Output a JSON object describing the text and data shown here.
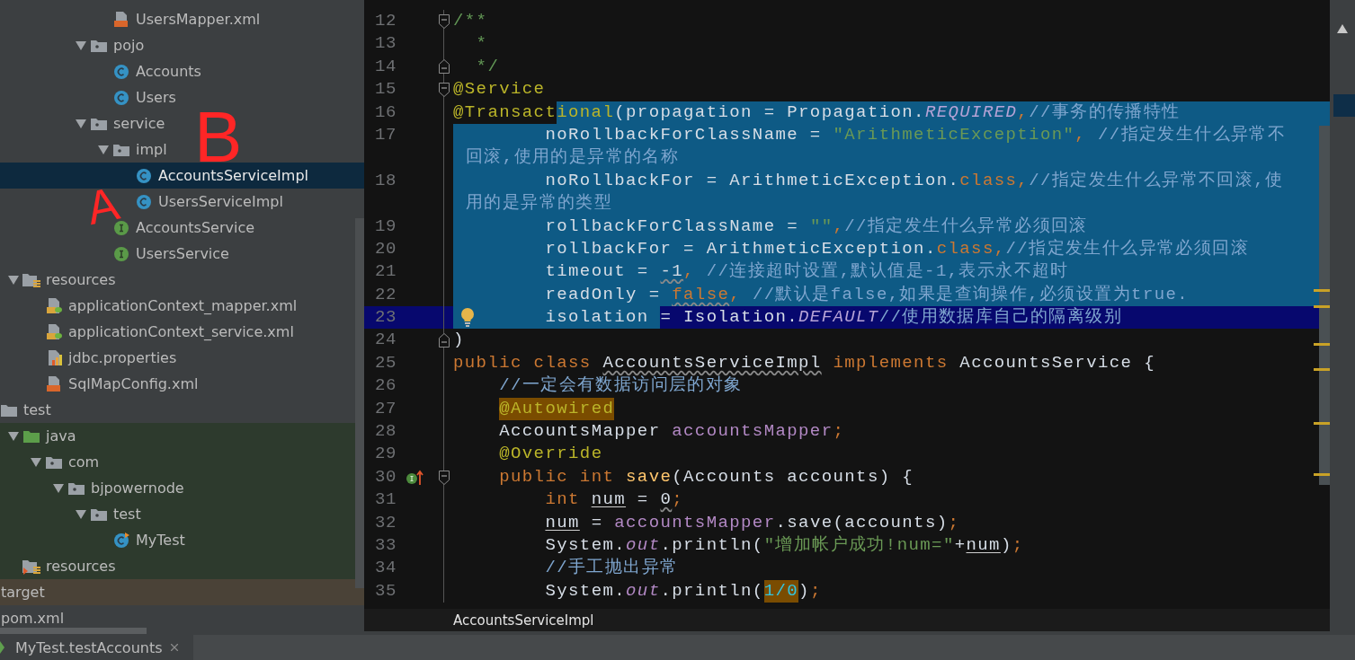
{
  "project_tree": {
    "items": [
      {
        "children": [
          {
            "children": [
              {
                "children": [
                  {
                    "children": [
                      {
                        "children": [
                          {
                            "children": [
                              {
                                "label": "UsersMapper.xml",
                                "kind": "xml",
                                "selected": false
                              }
                            ]
                          },
                          {
                            "label": "pojo",
                            "kind": "package",
                            "expanded": true,
                            "selected": false,
                            "children": [
                              {
                                "label": "Accounts",
                                "kind": "class",
                                "selected": false
                              },
                              {
                                "label": "Users",
                                "kind": "class",
                                "selected": false
                              }
                            ]
                          },
                          {
                            "label": "service",
                            "kind": "package",
                            "expanded": true,
                            "selected": false,
                            "children": [
                              {
                                "label": "impl",
                                "kind": "package",
                                "expanded": true,
                                "selected": false,
                                "children": [
                                  {
                                    "label": "AccountsServiceImpl",
                                    "kind": "class",
                                    "selected": true
                                  },
                                  {
                                    "label": "UsersServiceImpl",
                                    "kind": "class",
                                    "selected": false
                                  }
                                ]
                              },
                              {
                                "label": "AccountsService",
                                "kind": "interface",
                                "selected": false
                              },
                              {
                                "label": "UsersService",
                                "kind": "interface",
                                "selected": false
                              }
                            ]
                          }
                        ]
                      }
                    ]
                  }
                ]
              },
              {
                "label": "resources",
                "kind": "resources",
                "expanded": true,
                "selected": false,
                "children": [
                  {
                    "label": "applicationContext_mapper.xml",
                    "kind": "spring",
                    "selected": false
                  },
                  {
                    "label": "applicationContext_service.xml",
                    "kind": "spring",
                    "selected": false
                  },
                  {
                    "label": "jdbc.properties",
                    "kind": "properties",
                    "selected": false
                  },
                  {
                    "label": "SqlMapConfig.xml",
                    "kind": "xml",
                    "selected": false
                  }
                ]
              }
            ]
          },
          {
            "label": "test",
            "kind": "folder",
            "selected": false,
            "children": [
              {
                "label": "java",
                "kind": "source",
                "expanded": true,
                "selected": false,
                "color": "#2d3a2d",
                "children": [
                  {
                    "label": "com",
                    "kind": "package",
                    "expanded": true,
                    "selected": false,
                    "color": "#2d3a2d",
                    "children": [
                      {
                        "label": "bjpowernode",
                        "kind": "package",
                        "expanded": true,
                        "selected": false,
                        "color": "#2d3a2d",
                        "children": [
                          {
                            "label": "test",
                            "kind": "package",
                            "expanded": true,
                            "selected": false,
                            "color": "#2d3a2d",
                            "children": [
                              {
                                "label": "MyTest",
                                "kind": "testclass",
                                "selected": false,
                                "color": "#2d3a2d"
                              }
                            ]
                          }
                        ]
                      }
                    ]
                  }
                ]
              },
              {
                "label": "resources",
                "kind": "testresources",
                "selected": false,
                "color": "#2d3a2d"
              }
            ]
          }
        ]
      },
      {
        "label": "target",
        "selected": false,
        "color": "#4a4237"
      },
      {
        "label": "pom.xml",
        "selected": false
      }
    ]
  },
  "editor": {
    "lines": [
      {
        "number": "12",
        "fold_start": true,
        "selected": false,
        "current": false,
        "tokens": [
          {
            "text": "/**",
            "kind": "doc"
          }
        ]
      },
      {
        "number": "13",
        "selected": false,
        "current": false,
        "tokens": [
          {
            "text": "  *",
            "kind": "doc"
          }
        ]
      },
      {
        "number": "14",
        "fold_end": true,
        "selected": false,
        "current": false,
        "tokens": [
          {
            "text": "  */",
            "kind": "doc"
          }
        ]
      },
      {
        "number": "15",
        "fold_start": true,
        "selected": false,
        "current": false,
        "tokens": [
          {
            "text": "@Service",
            "kind": "annotation"
          }
        ]
      },
      {
        "number": "16",
        "selected": false,
        "current": false,
        "tokens": [
          {
            "text": "@Transact",
            "kind": "annotation",
            "selected": false
          },
          {
            "text": "ional",
            "kind": "annotation",
            "selected": true
          },
          {
            "text": "(propagation = Propagation.",
            "kind": "plain",
            "selected": true
          },
          {
            "text": "REQUIRED",
            "kind": "constant",
            "selected": true
          },
          {
            "text": ",",
            "kind": "keyword",
            "selected": true
          },
          {
            "text": "//事务的传播特性",
            "kind": "comment",
            "selected": true
          }
        ]
      },
      {
        "number": "17",
        "selected": true,
        "current": false,
        "tokens": [
          {
            "text": "        noRollbackForClassName = ",
            "kind": "plain"
          },
          {
            "text": "\"ArithmeticException\"",
            "kind": "string"
          },
          {
            "text": ", ",
            "kind": "keyword"
          },
          {
            "text": "//指定发生什么异常不",
            "kind": "comment"
          }
        ]
      },
      {
        "selected": true,
        "current": false,
        "tokens": [
          {
            "text": "回滚,使用的是异常的名称",
            "kind": "comment"
          }
        ]
      },
      {
        "number": "18",
        "selected": true,
        "current": false,
        "tokens": [
          {
            "text": "        noRollbackFor = ArithmeticException.",
            "kind": "plain"
          },
          {
            "text": "class",
            "kind": "keyword"
          },
          {
            "text": ",",
            "kind": "keyword"
          },
          {
            "text": "//指定发生什么异常不回滚,使",
            "kind": "comment"
          }
        ]
      },
      {
        "selected": true,
        "current": false,
        "tokens": [
          {
            "text": "用的是异常的类型",
            "kind": "comment"
          }
        ]
      },
      {
        "number": "19",
        "selected": true,
        "current": false,
        "tokens": [
          {
            "text": "        rollbackForClassName = ",
            "kind": "plain"
          },
          {
            "text": "\"\"",
            "kind": "string"
          },
          {
            "text": ",",
            "kind": "keyword"
          },
          {
            "text": "//指定发生什么异常必须回滚",
            "kind": "comment"
          }
        ]
      },
      {
        "number": "20",
        "selected": true,
        "current": false,
        "tokens": [
          {
            "text": "        rollbackFor = ArithmeticException.",
            "kind": "plain"
          },
          {
            "text": "class",
            "kind": "keyword"
          },
          {
            "text": ",",
            "kind": "keyword"
          },
          {
            "text": "//指定发生什么异常必须回滚",
            "kind": "comment"
          }
        ]
      },
      {
        "number": "21",
        "selected": true,
        "current": false,
        "tokens": [
          {
            "text": "        timeout = ",
            "kind": "plain"
          },
          {
            "text": "-1",
            "kind": "plain",
            "wavy": true
          },
          {
            "text": ", ",
            "kind": "keyword"
          },
          {
            "text": "//连接超时设置,默认值是-1,表示永不超时",
            "kind": "comment"
          }
        ]
      },
      {
        "number": "22",
        "selected": true,
        "current": false,
        "tokens": [
          {
            "text": "        readOnly = ",
            "kind": "plain"
          },
          {
            "text": "false",
            "kind": "keyword",
            "wavy": true
          },
          {
            "text": ", ",
            "kind": "keyword"
          },
          {
            "text": "//默认是false,如果是查询操作,必须设置为true.",
            "kind": "comment"
          }
        ]
      },
      {
        "number": "23",
        "selected": false,
        "current": true,
        "bulb": true,
        "tokens": [
          {
            "text": "        isolation ",
            "kind": "plain",
            "selected": true
          },
          {
            "text": "= Isolation.",
            "kind": "plain",
            "selected": false
          },
          {
            "text": "DEFAULT",
            "kind": "constant",
            "selected": false
          },
          {
            "text": "//使用数据库自己的隔离级别",
            "kind": "comment",
            "selected": false
          }
        ]
      },
      {
        "number": "24",
        "fold_end": true,
        "selected": false,
        "current": false,
        "tokens": [
          {
            "text": ")",
            "kind": "plain"
          }
        ]
      },
      {
        "number": "25",
        "selected": false,
        "current": false,
        "tokens": [
          {
            "text": "public class ",
            "kind": "keyword"
          },
          {
            "text": "AccountsServiceImpl",
            "kind": "plain",
            "wavy": true
          },
          {
            "text": " implements ",
            "kind": "keyword"
          },
          {
            "text": "AccountsService {",
            "kind": "plain"
          }
        ]
      },
      {
        "number": "26",
        "selected": false,
        "current": false,
        "tokens": [
          {
            "text": "    //一定会有数据访问层的对象",
            "kind": "comment"
          }
        ]
      },
      {
        "number": "27",
        "selected": false,
        "current": false,
        "tokens": [
          {
            "text": "    @Autowired",
            "kind": "annotation",
            "marked": true
          }
        ]
      },
      {
        "number": "28",
        "selected": false,
        "current": false,
        "tokens": [
          {
            "text": "    AccountsMapper ",
            "kind": "plain"
          },
          {
            "text": "accountsMapper",
            "kind": "field"
          },
          {
            "text": ";",
            "kind": "keyword"
          }
        ]
      },
      {
        "number": "29",
        "selected": false,
        "current": false,
        "tokens": [
          {
            "text": "    @Override",
            "kind": "annotation"
          }
        ]
      },
      {
        "number": "30",
        "fold_start": true,
        "implements_marker": true,
        "selected": false,
        "current": false,
        "tokens": [
          {
            "text": "    public int ",
            "kind": "keyword"
          },
          {
            "text": "save",
            "kind": "method"
          },
          {
            "text": "(Accounts accounts) {",
            "kind": "plain"
          }
        ]
      },
      {
        "number": "31",
        "selected": false,
        "current": false,
        "tokens": [
          {
            "text": "        int ",
            "kind": "keyword"
          },
          {
            "text": "num",
            "kind": "plain",
            "underlined": true
          },
          {
            "text": " = ",
            "kind": "plain"
          },
          {
            "text": "0",
            "kind": "plain",
            "wavy": true
          },
          {
            "text": ";",
            "kind": "keyword"
          }
        ]
      },
      {
        "number": "32",
        "selected": false,
        "current": false,
        "tokens": [
          {
            "text": "        num",
            "kind": "plain",
            "underlined": true
          },
          {
            "text": " = ",
            "kind": "plain"
          },
          {
            "text": "accountsMapper",
            "kind": "field"
          },
          {
            "text": ".save(accounts)",
            "kind": "plain"
          },
          {
            "text": ";",
            "kind": "keyword"
          }
        ]
      },
      {
        "number": "33",
        "selected": false,
        "current": false,
        "tokens": [
          {
            "text": "        System.",
            "kind": "plain"
          },
          {
            "text": "out",
            "kind": "static"
          },
          {
            "text": ".println(",
            "kind": "plain"
          },
          {
            "text": "\"增加帐户成功!num=\"",
            "kind": "string"
          },
          {
            "text": "+",
            "kind": "plain"
          },
          {
            "text": "num",
            "kind": "plain",
            "underlined": true
          },
          {
            "text": ")",
            "kind": "plain"
          },
          {
            "text": ";",
            "kind": "keyword"
          }
        ]
      },
      {
        "number": "34",
        "selected": false,
        "current": false,
        "tokens": [
          {
            "text": "        //手工抛出异常",
            "kind": "comment"
          }
        ]
      },
      {
        "number": "35",
        "selected": false,
        "current": false,
        "tokens": [
          {
            "text": "        System.",
            "kind": "plain"
          },
          {
            "text": "out",
            "kind": "static"
          },
          {
            "text": ".println(",
            "kind": "plain"
          },
          {
            "text": "1/0",
            "kind": "number",
            "marked": true
          },
          {
            "text": ")",
            "kind": "plain"
          },
          {
            "text": ";",
            "kind": "keyword"
          }
        ]
      }
    ],
    "breadcrumb": "AccountsServiceImpl"
  },
  "run_tab": {
    "label": "MyTest.testAccounts"
  },
  "annotations": [
    {
      "text": "B",
      "color": "#ff2626"
    },
    {
      "text": "A",
      "color": "#ff2626"
    }
  ]
}
